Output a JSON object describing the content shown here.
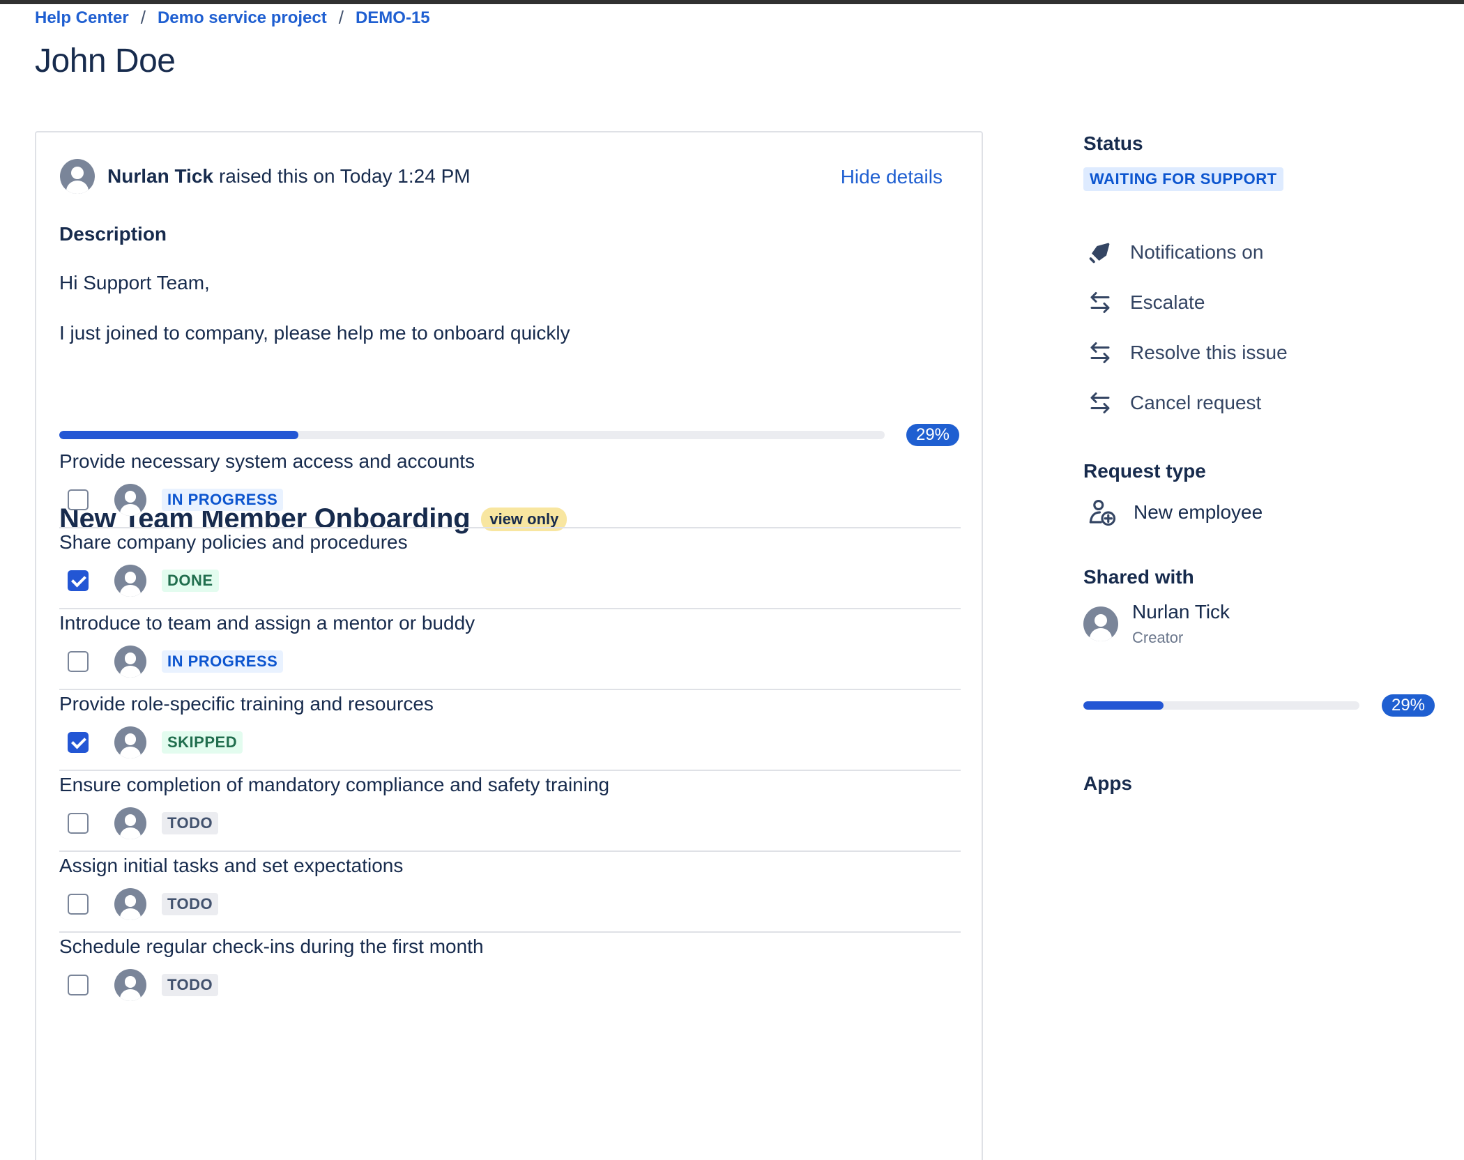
{
  "breadcrumb": {
    "items": [
      "Help Center",
      "Demo service project",
      "DEMO-15"
    ],
    "separator": "/"
  },
  "page_title": "John Doe",
  "request": {
    "author": "Nurlan Tick",
    "raised_text": "raised this on Today 1:24 PM",
    "hide_details": "Hide details",
    "description_heading": "Description",
    "description_lines": [
      "Hi Support Team,",
      "I just joined to company, please help me to onboard quickly"
    ]
  },
  "checklist": {
    "title": "New Team Member Onboarding",
    "badge": "view only",
    "progress": 0.29,
    "progress_label": "29%",
    "items": [
      {
        "title": "Provide necessary system access and accounts",
        "checked": false,
        "status": "IN PROGRESS"
      },
      {
        "title": "Share company policies and procedures",
        "checked": true,
        "status": "DONE"
      },
      {
        "title": "Introduce to team and assign a mentor or buddy",
        "checked": false,
        "status": "IN PROGRESS"
      },
      {
        "title": "Provide role-specific training and resources",
        "checked": true,
        "status": "SKIPPED"
      },
      {
        "title": "Ensure completion of mandatory compliance and safety training",
        "checked": false,
        "status": "TODO"
      },
      {
        "title": "Assign initial tasks and set expectations",
        "checked": false,
        "status": "TODO"
      },
      {
        "title": "Schedule regular check-ins during the first month",
        "checked": false,
        "status": "TODO"
      }
    ]
  },
  "sidebar": {
    "status_heading": "Status",
    "status_value": "WAITING FOR SUPPORT",
    "actions": [
      {
        "label": "Notifications on",
        "icon": "bell-icon"
      },
      {
        "label": "Escalate",
        "icon": "transition-arrows-icon"
      },
      {
        "label": "Resolve this issue",
        "icon": "transition-arrows-icon"
      },
      {
        "label": "Cancel request",
        "icon": "transition-arrows-icon"
      }
    ],
    "request_type_heading": "Request type",
    "request_type": "New employee",
    "shared_with_heading": "Shared with",
    "shared_user": {
      "name": "Nurlan Tick",
      "role": "Creator"
    },
    "progress": 0.29,
    "progress_label": "29%",
    "apps_heading": "Apps"
  },
  "colors": {
    "link": "#1f5fd1",
    "progress": "#2356d4",
    "text": "#172b4d"
  }
}
